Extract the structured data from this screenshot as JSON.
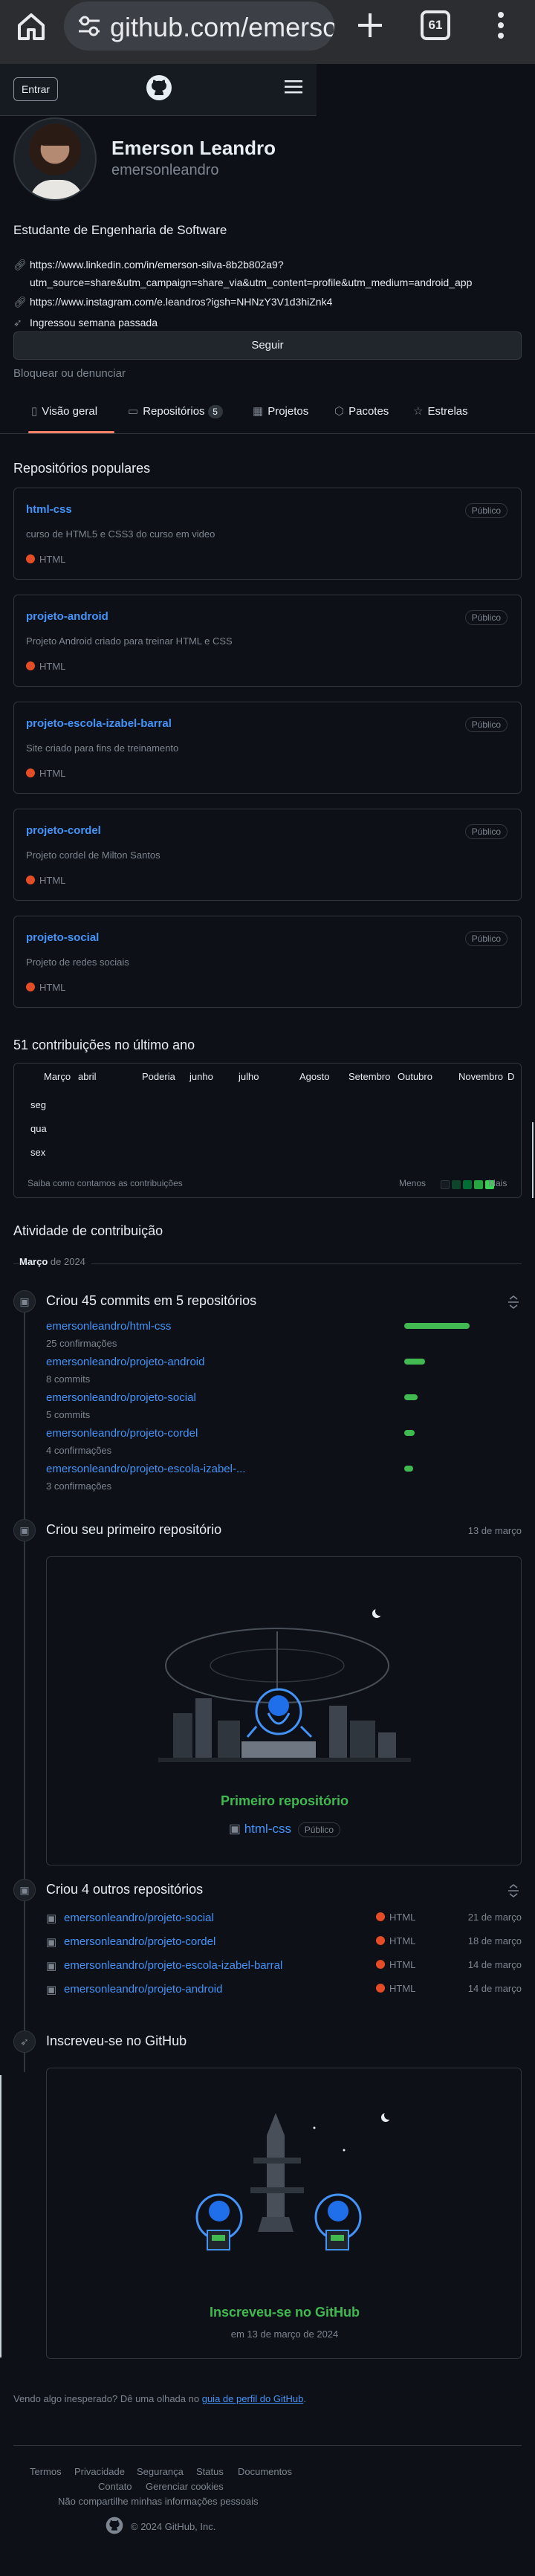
{
  "browser": {
    "url": "github.com/emersonle",
    "tab_count": "61"
  },
  "header": {
    "sign_in": "Entrar"
  },
  "profile": {
    "name": "Emerson Leandro",
    "login": "emersonleandro",
    "bio": "Estudante de Engenharia de Software",
    "linkedin_line1": "https://www.linkedin.com/in/emerson-silva-8b2b802a9?",
    "linkedin_line2": "utm_source=share&utm_campaign=share_via&utm_content=profile&utm_medium=android_app",
    "instagram": "https://www.instagram.com/e.leandros?igsh=NHNzY3V1d3hiZnk4",
    "joined": "Ingressou semana passada",
    "follow": "Seguir",
    "block": "Bloquear ou denunciar"
  },
  "tabs": {
    "overview": "Visão geral",
    "repositories": "Repositórios",
    "repositories_count": "5",
    "projects": "Projetos",
    "packages": "Pacotes",
    "stars": "Estrelas"
  },
  "popular": {
    "title": "Repositórios populares",
    "repos": [
      {
        "name": "html-css",
        "visibility": "Público",
        "description": "curso de HTML5 e CSS3 do curso em video",
        "language": "HTML"
      },
      {
        "name": "projeto-android",
        "visibility": "Público",
        "description": "Projeto Android criado para treinar HTML e CSS",
        "language": "HTML"
      },
      {
        "name": "projeto-escola-izabel-barral",
        "visibility": "Público",
        "description": "Site criado para fins de treinamento",
        "language": "HTML"
      },
      {
        "name": "projeto-cordel",
        "visibility": "Público",
        "description": "Projeto cordel de Milton Santos",
        "language": "HTML"
      },
      {
        "name": "projeto-social",
        "visibility": "Público",
        "description": "Projeto de redes sociais",
        "language": "HTML"
      }
    ]
  },
  "contributions": {
    "title": "51 contribuições no último ano",
    "months": [
      "Março",
      "abril",
      "Poderia",
      "junho",
      "julho",
      "Agosto",
      "Setembro",
      "Outubro",
      "Novembro",
      "D"
    ],
    "days": [
      "seg",
      "qua",
      "sex"
    ],
    "help": "Saiba como contamos as contribuições",
    "less": "Menos",
    "more": "Mais"
  },
  "activity": {
    "title": "Atividade de contribuição",
    "period_month": "Março",
    "period_year": "de 2024",
    "commits": {
      "title": "Criou 45 commits em 5 repositórios",
      "items": [
        {
          "repo": "emersonleandro/html-css",
          "count": "25 confirmações",
          "commits": 25
        },
        {
          "repo": "emersonleandro/projeto-android",
          "count": "8 commits",
          "commits": 8
        },
        {
          "repo": "emersonleandro/projeto-social",
          "count": "5 commits",
          "commits": 5
        },
        {
          "repo": "emersonleandro/projeto-cordel",
          "count": "4 confirmações",
          "commits": 4
        },
        {
          "repo": "emersonleandro/projeto-escola-izabel-...",
          "count": "3 confirmações",
          "commits": 3
        }
      ]
    },
    "first_repo": {
      "title": "Criou seu primeiro repositório",
      "date": "13 de março",
      "card_title": "Primeiro repositório",
      "repo": "html-css",
      "visibility": "Público"
    },
    "other_repos": {
      "title": "Criou 4 outros repositórios",
      "items": [
        {
          "repo": "emersonleandro/projeto-social",
          "language": "HTML",
          "date": "21 de março"
        },
        {
          "repo": "emersonleandro/projeto-cordel",
          "language": "HTML",
          "date": "18 de março"
        },
        {
          "repo": "emersonleandro/projeto-escola-izabel-barral",
          "language": "HTML",
          "date": "14 de março"
        },
        {
          "repo": "emersonleandro/projeto-android",
          "language": "HTML",
          "date": "14 de março"
        }
      ]
    },
    "joined": {
      "title": "Inscreveu-se no GitHub",
      "card_title": "Inscreveu-se no GitHub",
      "card_date": "em 13 de março de 2024"
    }
  },
  "footer": {
    "unexpected": "Vendo algo inesperado? Dê uma olhada no",
    "guide": "guia de perfil do GitHub",
    "guide_end": ".",
    "terms": "Termos",
    "privacy": "Privacidade",
    "security": "Segurança",
    "status": "Status",
    "docs": "Documentos",
    "contact": "Contato",
    "cookies": "Gerenciar cookies",
    "no_share": "Não compartilhe minhas informações pessoais",
    "copyright": "© 2024 GitHub, Inc."
  },
  "colors": {
    "accent_link": "#4493f8",
    "green": "#3fb950",
    "html_lang": "#e34c26",
    "tab_underline": "#f78166"
  }
}
